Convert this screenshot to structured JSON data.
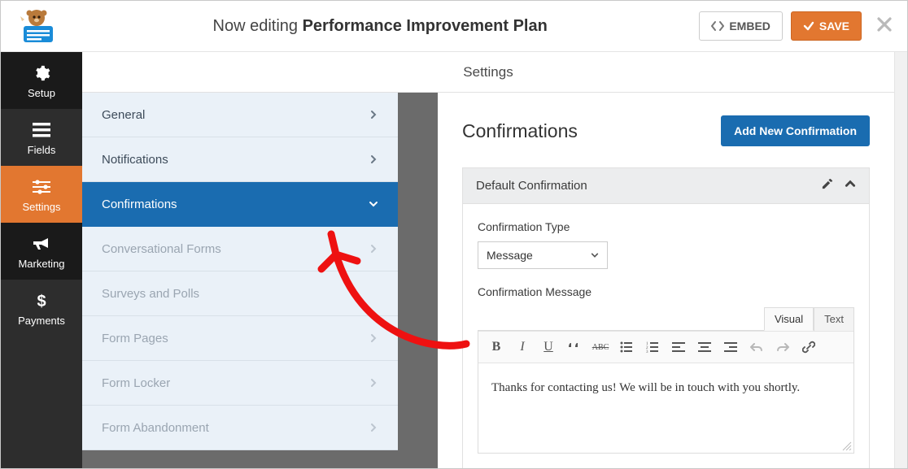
{
  "topbar": {
    "editing_prefix": "Now editing ",
    "form_name": "Performance Improvement Plan",
    "embed_label": "EMBED",
    "save_label": "SAVE"
  },
  "sidebar": {
    "items": [
      {
        "id": "setup",
        "label": "Setup",
        "icon": "gear-icon"
      },
      {
        "id": "fields",
        "label": "Fields",
        "icon": "list-icon"
      },
      {
        "id": "settings",
        "label": "Settings",
        "icon": "sliders-icon",
        "active": true
      },
      {
        "id": "marketing",
        "label": "Marketing",
        "icon": "bullhorn-icon"
      },
      {
        "id": "payments",
        "label": "Payments",
        "icon": "dollar-icon"
      }
    ]
  },
  "main": {
    "header": "Settings"
  },
  "settings_nav": {
    "items": [
      {
        "label": "General",
        "state": "normal"
      },
      {
        "label": "Notifications",
        "state": "normal"
      },
      {
        "label": "Confirmations",
        "state": "active"
      },
      {
        "label": "Conversational Forms",
        "state": "disabled"
      },
      {
        "label": "Surveys and Polls",
        "state": "disabled"
      },
      {
        "label": "Form Pages",
        "state": "disabled"
      },
      {
        "label": "Form Locker",
        "state": "disabled"
      },
      {
        "label": "Form Abandonment",
        "state": "disabled"
      }
    ]
  },
  "panel": {
    "title": "Confirmations",
    "add_button": "Add New Confirmation",
    "card_title": "Default Confirmation",
    "field_type_label": "Confirmation Type",
    "field_type_value": "Message",
    "field_message_label": "Confirmation Message",
    "tabs": {
      "visual": "Visual",
      "text": "Text"
    },
    "message_body": "Thanks for contacting us! We will be in touch with you shortly."
  },
  "icons": {
    "bold": "B",
    "italic": "I",
    "underline": "U",
    "abc": "ABC"
  }
}
